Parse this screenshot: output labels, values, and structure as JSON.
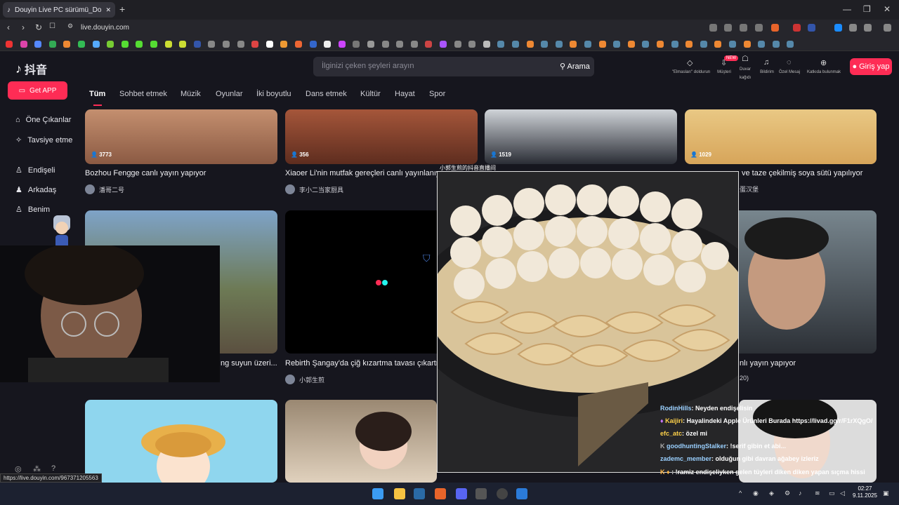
{
  "browser": {
    "tab_title": "Douyin Live PC sürümü_Douyin",
    "new_tab": "+",
    "win_minimize": "—",
    "win_restore": "❐",
    "win_close": "✕",
    "url": "live.douyin.com",
    "back": "‹",
    "forward": "›",
    "reload": "↻"
  },
  "site": {
    "logo_text": "抖音",
    "search_placeholder": "İlginizi çeken şeyleri arayın",
    "search_button": "Arama",
    "header_items": [
      {
        "label": "\"Elmasları\" doldurun",
        "icon": "diamond-icon"
      },
      {
        "label": "Müşteri",
        "icon": "download-icon"
      },
      {
        "label": "Duvar kağıdı",
        "icon": "wallpaper-icon"
      },
      {
        "label": "Bildirim",
        "icon": "bell-icon"
      },
      {
        "label": "Özel Mesaj",
        "icon": "message-icon"
      },
      {
        "label": "Katkıda bulunmak",
        "icon": "plus-icon"
      }
    ],
    "new_badge": "NEW",
    "login": "Giriş yap",
    "get_app": "Get APP",
    "categories": [
      "Tüm",
      "Sohbet etmek",
      "Müzik",
      "Oyunlar",
      "İki boyutlu",
      "Dans etmek",
      "Kültür",
      "Hayat",
      "Spor"
    ],
    "sidebar": [
      {
        "label": "Öne Çıkanlar",
        "icon": "home-icon"
      },
      {
        "label": "Tavsiye etme",
        "icon": "recommend-icon"
      },
      {
        "label": "Endişeli",
        "icon": "follow-icon"
      },
      {
        "label": "Arkadaş",
        "icon": "friends-icon"
      },
      {
        "label": "Benim",
        "icon": "profile-icon"
      }
    ]
  },
  "streams": [
    {
      "viewers": "3773",
      "title": "Bozhou Fengge canlı yayın yapıyor",
      "author": "潘哥二号"
    },
    {
      "viewers": "356",
      "title": "Xiaoer Li'nin mutfak gereçleri canlı yayınlanıyor",
      "author": "李小二当家厨具"
    },
    {
      "viewers": "1519",
      "title": "",
      "author": ""
    },
    {
      "viewers": "1029",
      "title": "ve taze çekilmiş soya sütü yapılıyor",
      "author": "蛋汉堡"
    },
    {
      "viewers": "",
      "title": "ng suyun üzeri...",
      "author": ""
    },
    {
      "viewers": "",
      "title": "Rebirth Şangay'da çiğ kızartma tavası çıkartm",
      "author": "小郭生煎"
    },
    {
      "viewers": "",
      "title": "nlı yayın yapıyor",
      "author": "20)"
    }
  ],
  "popup": {
    "title": "小郭生煎的抖音直播间"
  },
  "chat": [
    {
      "user": "RodinHills",
      "msg": ": Neyden endişelisin"
    },
    {
      "user": "Kaijiri",
      "msg": ": Hayalindeki Apple Ürünleri Burada https://livad.gg/r/F1rXQgO/"
    },
    {
      "user": "efc_atc",
      "msg": ": özel mi"
    },
    {
      "user": "goodhuntingStalker",
      "msg": ": !serif gibin et abi..."
    },
    {
      "user": "zademc_member",
      "msg": ": olduğun gibi davran ağabey izleriz"
    },
    {
      "user": "",
      "msg": ": !ramiz endişeliyken gelen tüyleri diken diken yapan sıçma hissi"
    }
  ],
  "status_url": "https://live.douyin.com/967371205563",
  "taskbar": {
    "time": "02:27",
    "date": "9.11.2025"
  },
  "colors": {
    "accent": "#fe2c55",
    "bg": "#16161e"
  }
}
